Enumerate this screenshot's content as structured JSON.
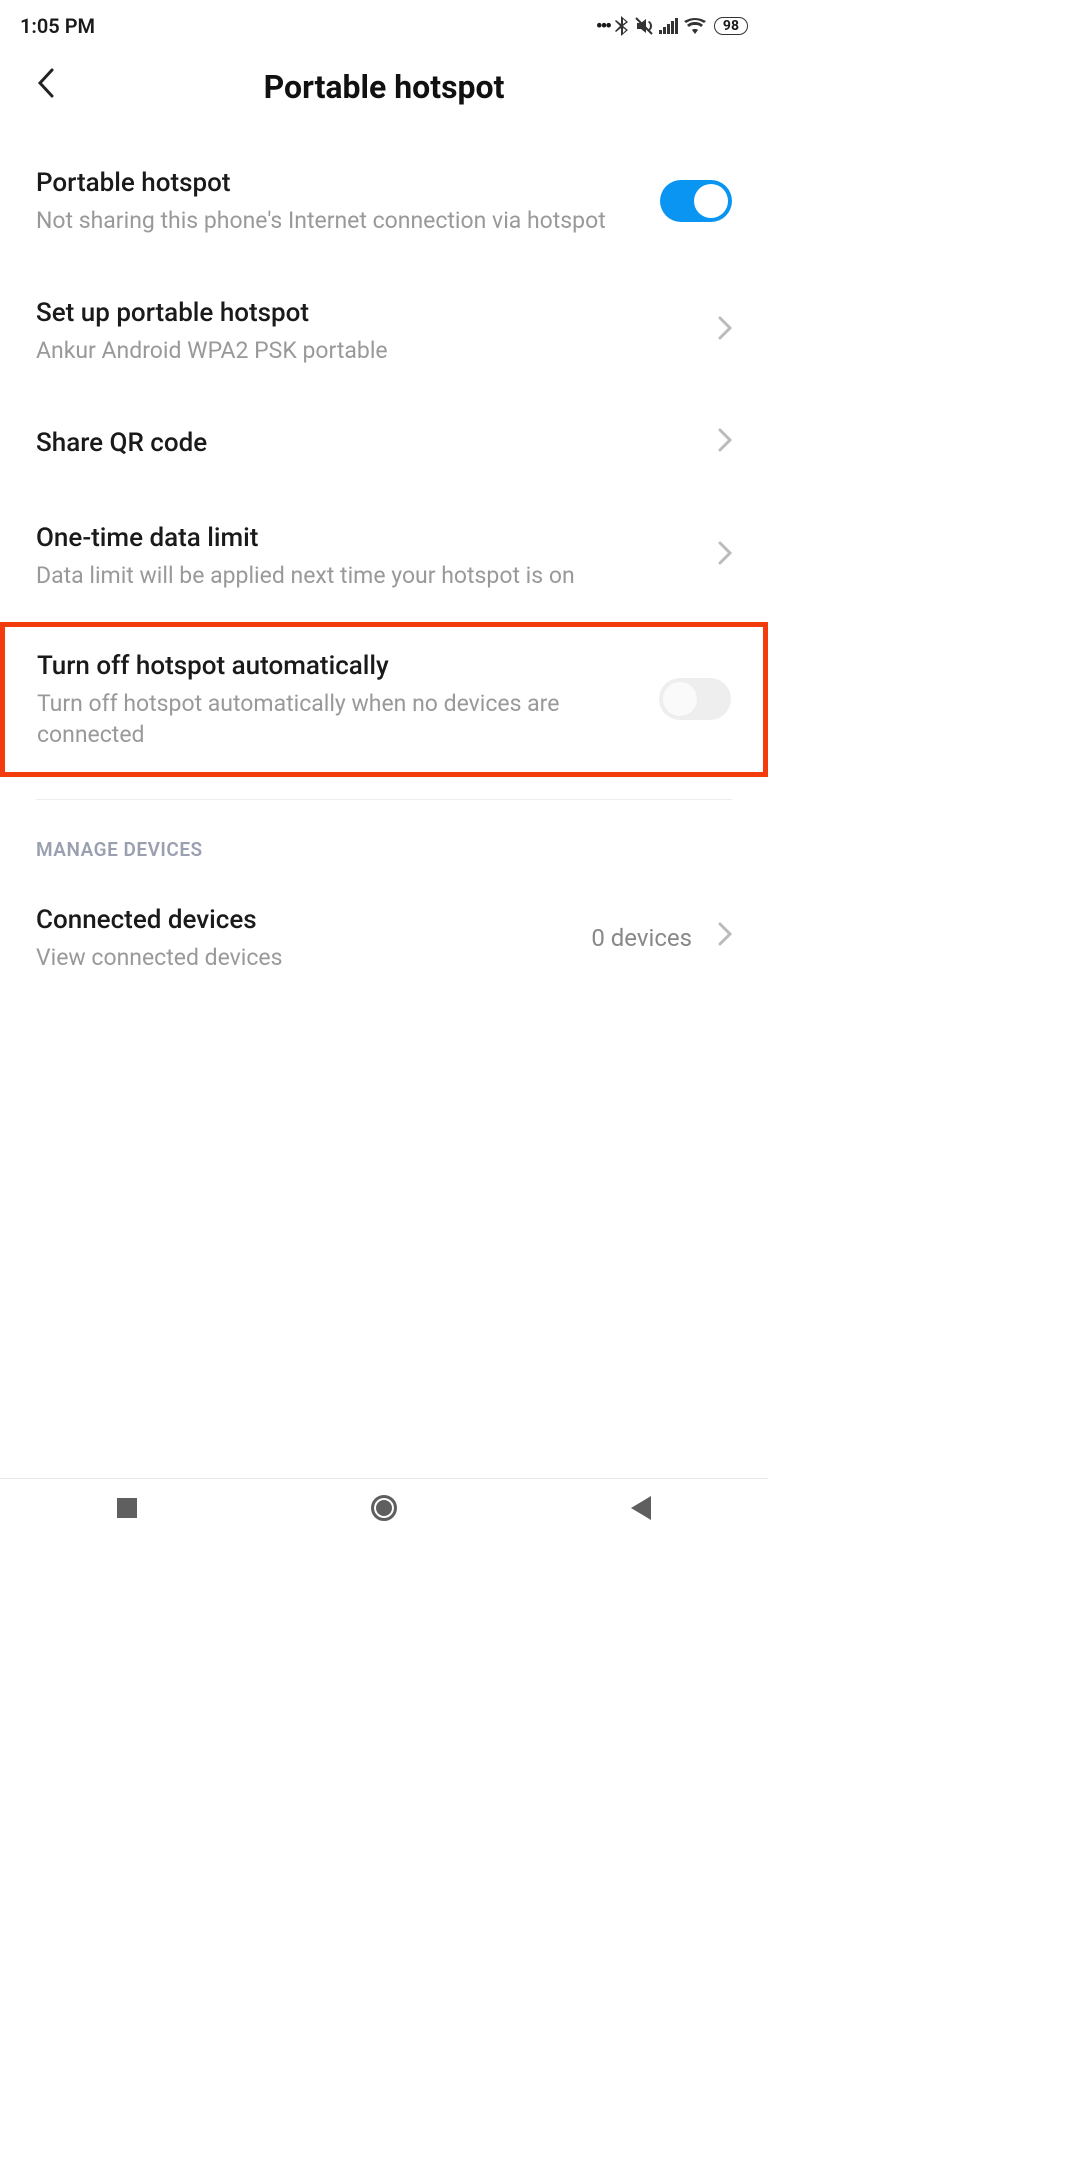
{
  "status": {
    "time": "1:05 PM",
    "battery": "98"
  },
  "header": {
    "title": "Portable hotspot"
  },
  "rows": {
    "hotspot": {
      "title": "Portable hotspot",
      "sub": "Not sharing this phone's Internet connection via hotspot"
    },
    "setup": {
      "title": "Set up portable hotspot",
      "sub": "Ankur Android WPA2 PSK portable"
    },
    "qr": {
      "title": "Share QR code"
    },
    "datalimit": {
      "title": "One-time data limit",
      "sub": "Data limit will be applied next time your hotspot is on"
    },
    "auto_off": {
      "title": "Turn off hotspot automatically",
      "sub": "Turn off hotspot automatically when no devices are connected"
    },
    "connected": {
      "title": "Connected devices",
      "sub": "View connected devices",
      "value": "0 devices"
    }
  },
  "section": {
    "manage": "MANAGE DEVICES"
  },
  "toggles": {
    "hotspot_on": true,
    "auto_off_on": false
  }
}
